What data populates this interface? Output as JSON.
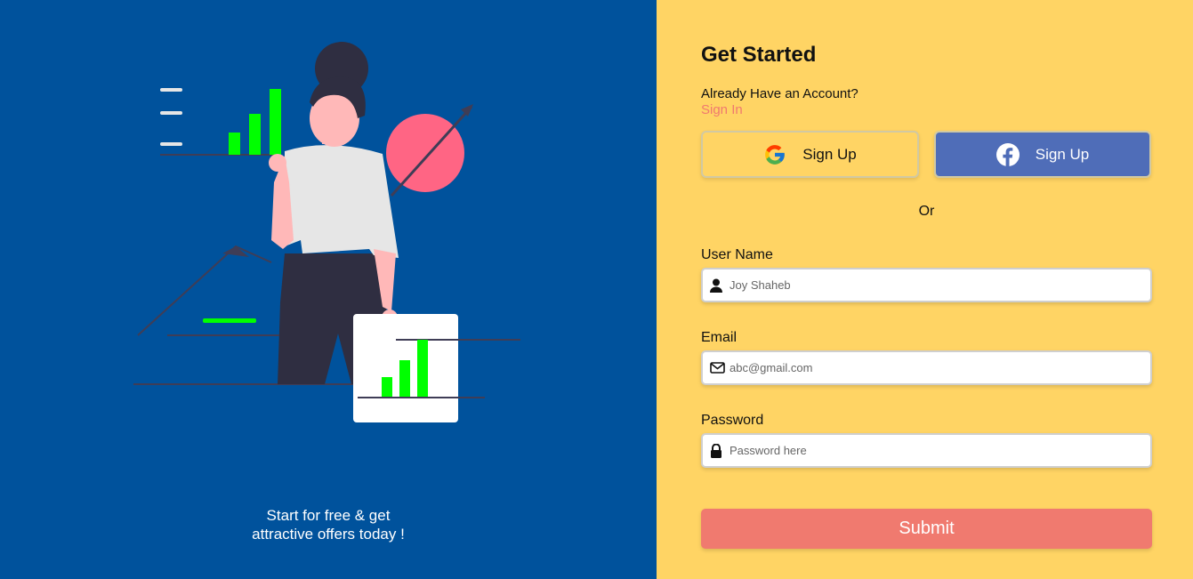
{
  "hero": {
    "tagline_line1": "Start for free & get",
    "tagline_line2": "attractive offers today !"
  },
  "form": {
    "title": "Get Started",
    "account_prompt": "Already Have an Account?",
    "signin_label": "Sign In",
    "google_signup_label": "Sign Up",
    "facebook_signup_label": "Sign Up",
    "or_label": "Or",
    "username": {
      "label": "User Name",
      "placeholder": "Joy Shaheb",
      "icon": "user-icon"
    },
    "email": {
      "label": "Email",
      "placeholder": "abc@gmail.com",
      "icon": "envelope-icon"
    },
    "password": {
      "label": "Password",
      "placeholder": "Password here",
      "icon": "lock-icon"
    },
    "submit_label": "Submit"
  },
  "colors": {
    "left_bg": "#00529c",
    "right_bg": "#ffd464",
    "accent": "#f07a6f",
    "facebook": "#4f6db8",
    "chart_green": "#00ff00",
    "circle_pink": "#ff6584"
  }
}
